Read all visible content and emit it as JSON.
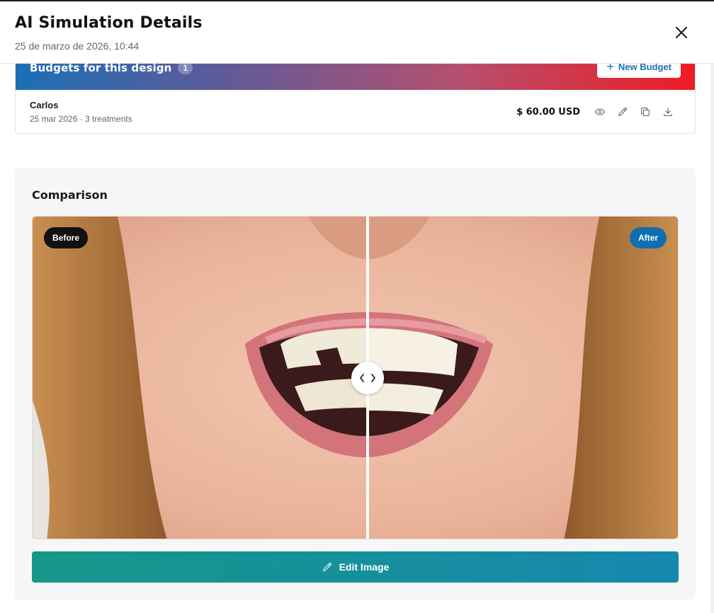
{
  "header": {
    "title": "AI Simulation Details",
    "date": "25 de marzo de 2026, 10:44",
    "close_icon": "close-icon"
  },
  "budgets": {
    "title": "Budgets for this design",
    "count": "1",
    "new_budget_label": "New Budget",
    "banner_colors": [
      "#1c6fb4",
      "#ee1c24"
    ],
    "items": [
      {
        "name": "Carlos",
        "meta": "25 mar 2026 · 3 treatments",
        "amount": "$ 60.00 USD",
        "actions": [
          "eye-icon",
          "pencil-icon",
          "copy-icon",
          "download-icon"
        ]
      }
    ]
  },
  "comparison": {
    "title": "Comparison",
    "before_label": "Before",
    "after_label": "After",
    "slider_position": 0.52,
    "edit_button_label": "Edit Image",
    "accent_colors": {
      "before_badge": "#111111",
      "after_badge": "#0f6fb0",
      "edit_gradient": [
        "#17978a",
        "#1588ae"
      ]
    }
  }
}
